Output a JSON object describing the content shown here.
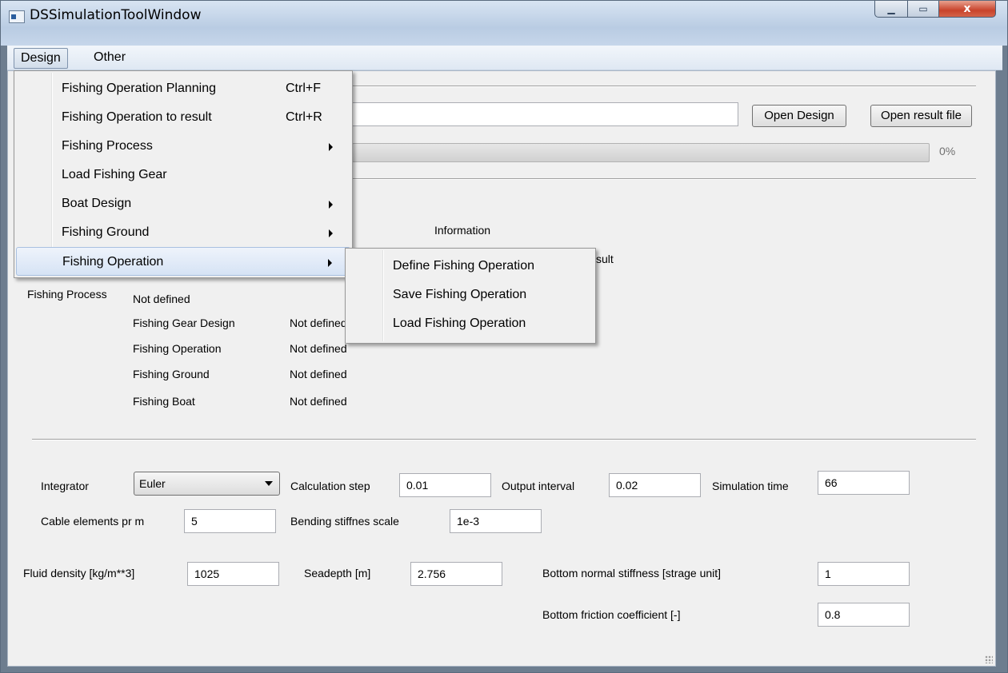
{
  "window": {
    "title": "DSSimulationToolWindow",
    "close_glyph": "x"
  },
  "menubar": {
    "items": [
      {
        "label": "Design"
      },
      {
        "label": "Other"
      }
    ]
  },
  "design_menu": {
    "items": [
      {
        "label": "Fishing Operation Planning",
        "shortcut": "Ctrl+F"
      },
      {
        "label": "Fishing Operation to result",
        "shortcut": "Ctrl+R"
      },
      {
        "label": "Fishing Process",
        "has_submenu": true
      },
      {
        "label": "Load Fishing Gear"
      },
      {
        "label": "Boat Design",
        "has_submenu": true
      },
      {
        "label": "Fishing Ground",
        "has_submenu": true
      },
      {
        "label": "Fishing Operation",
        "has_submenu": true,
        "highlighted": true
      }
    ]
  },
  "fishing_operation_submenu": {
    "items": [
      {
        "label": "Define Fishing Operation"
      },
      {
        "label": "Save Fishing Operation"
      },
      {
        "label": "Load Fishing Operation"
      }
    ]
  },
  "top": {
    "open_design_label": "Open Design",
    "open_result_label": "Open result file",
    "design_path": "",
    "progress": {
      "value": 0,
      "label": "0%"
    }
  },
  "info": {
    "information_label": "Information",
    "partial_result_text": "sult",
    "fishing_process_label": "Fishing Process",
    "fishing_process_value": "Not defined",
    "rows": [
      {
        "label": "Fishing Gear Design",
        "value": "Not defined"
      },
      {
        "label": "Fishing Operation",
        "value": "Not defined"
      },
      {
        "label": "Fishing Ground",
        "value": "Not defined"
      },
      {
        "label": "Fishing Boat",
        "value": "Not defined"
      }
    ]
  },
  "params": {
    "integrator_label": "Integrator",
    "integrator_value": "Euler",
    "calc_step_label": "Calculation step",
    "calc_step_value": "0.01",
    "output_interval_label": "Output interval",
    "output_interval_value": "0.02",
    "sim_time_label": "Simulation time",
    "sim_time_value": "66",
    "cable_elements_label": "Cable elements pr m",
    "cable_elements_value": "5",
    "bending_label": "Bending stiffnes scale",
    "bending_value": "1e-3",
    "fluid_density_label": "Fluid density [kg/m**3]",
    "fluid_density_value": "1025",
    "seadepth_label": "Seadepth [m]",
    "seadepth_value": "2.756",
    "bottom_normal_label": "Bottom normal stiffness [strage unit]",
    "bottom_normal_value": "1",
    "bottom_friction_label": "Bottom friction coefficient [-]",
    "bottom_friction_value": "0.8"
  }
}
